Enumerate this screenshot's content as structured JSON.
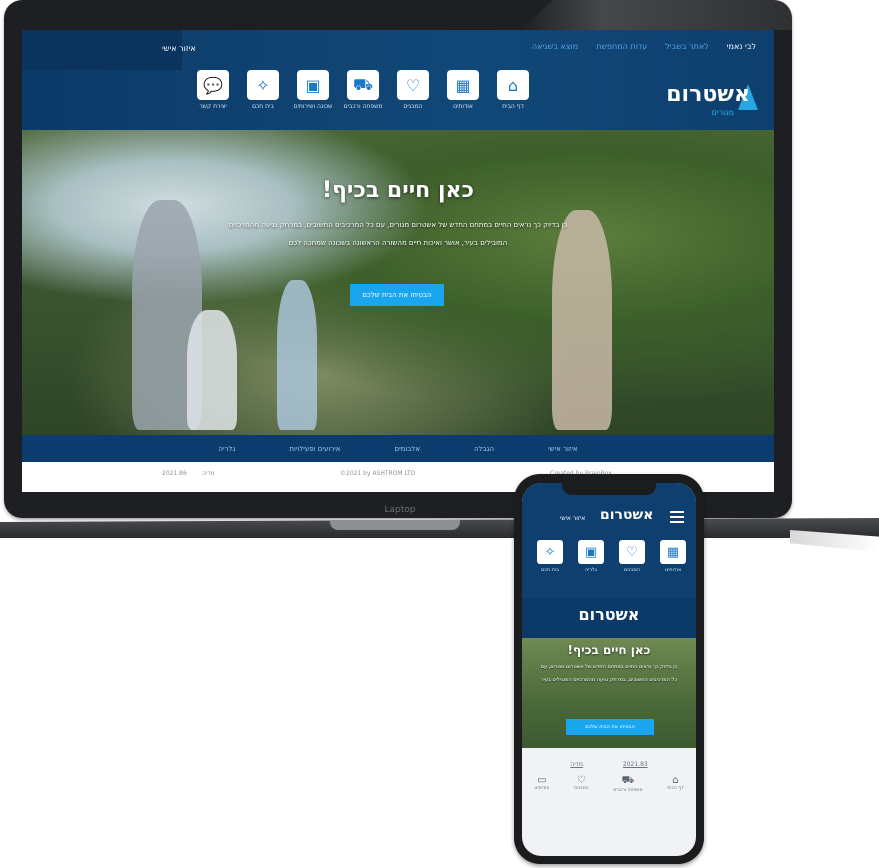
{
  "laptop": {
    "label": "Laptop",
    "top_nav": [
      "לבי נאמי",
      "לאתר בשביל",
      "עדות המחפשת",
      "מוצא בשגיאה"
    ],
    "login": "איזור אישי",
    "logo": {
      "main": "אשטרום",
      "sub": "מגורים"
    },
    "icons": [
      {
        "icon": "home-icon",
        "glyph": "⌂",
        "label": "דף הבית"
      },
      {
        "icon": "newspaper-icon",
        "glyph": "▦",
        "label": "אודותינו"
      },
      {
        "icon": "heart-icon",
        "glyph": "♡",
        "label": "המבנים"
      },
      {
        "icon": "car-icon",
        "glyph": "⛟",
        "label": "משפחה ורכבים"
      },
      {
        "icon": "building-icon",
        "glyph": "▣",
        "label": "שכונה ושירותים"
      },
      {
        "icon": "sparkle-icon",
        "glyph": "✧",
        "label": "בית חכם"
      },
      {
        "icon": "chat-icon",
        "glyph": "💬",
        "label": "יצירת קשר"
      }
    ],
    "hero": {
      "title": "כאן חיים בכיף!",
      "text": "כן בדיוק כך נראים החיים במתחם החדש של אשטרום מגורים, עם כל המרכיבים החשובים, במרחק נגיעה מהמרכזים המובילים בעיר, אושר ואיכות חיים מהשורה הראשונה בשכונה שמחכה לכם",
      "button": "הבטיחו את הבית שלכם"
    },
    "footer_nav": [
      "איזור אישי",
      "הגבלה",
      "אלבומים",
      "אירועים ופעילויות",
      "גלריה"
    ],
    "bottom": {
      "links": [
        "2021.86",
        "מדיה"
      ],
      "copyright": "©2021 by ASHTROM LTD",
      "credit": "Created by BrainBox"
    }
  },
  "phone": {
    "login": "איזור אישי",
    "logo": "אשטרום",
    "icons": [
      {
        "icon": "newspaper-icon",
        "glyph": "▦",
        "label": "אודותינו"
      },
      {
        "icon": "heart-icon",
        "glyph": "♡",
        "label": "המבנים"
      },
      {
        "icon": "building-icon",
        "glyph": "▣",
        "label": "גלריה"
      },
      {
        "icon": "sparkle-icon",
        "glyph": "✧",
        "label": "בית חכם"
      }
    ],
    "logo2": "אשטרום",
    "hero": {
      "title": "כאן חיים בכיף!",
      "text": "כן בדיוק כך נראים החיים במתחם החדש של אשטרום מגורים, עם כל המרכיבים החשובים, במרחק נגיעה מהמרכזים המובילים בעיר",
      "button": "הבטיחו את הבית שלכם"
    },
    "links": [
      "מדיה",
      "2021.83"
    ],
    "tabs": [
      {
        "icon": "home-icon",
        "glyph": "⌂",
        "label": "דף הבית"
      },
      {
        "icon": "car-icon",
        "glyph": "⛟",
        "label": "משפחה ורכבים"
      },
      {
        "icon": "heart-icon",
        "glyph": "♡",
        "label": "המבנים"
      },
      {
        "icon": "monitor-icon",
        "glyph": "▭",
        "label": "אודותינו"
      }
    ]
  }
}
